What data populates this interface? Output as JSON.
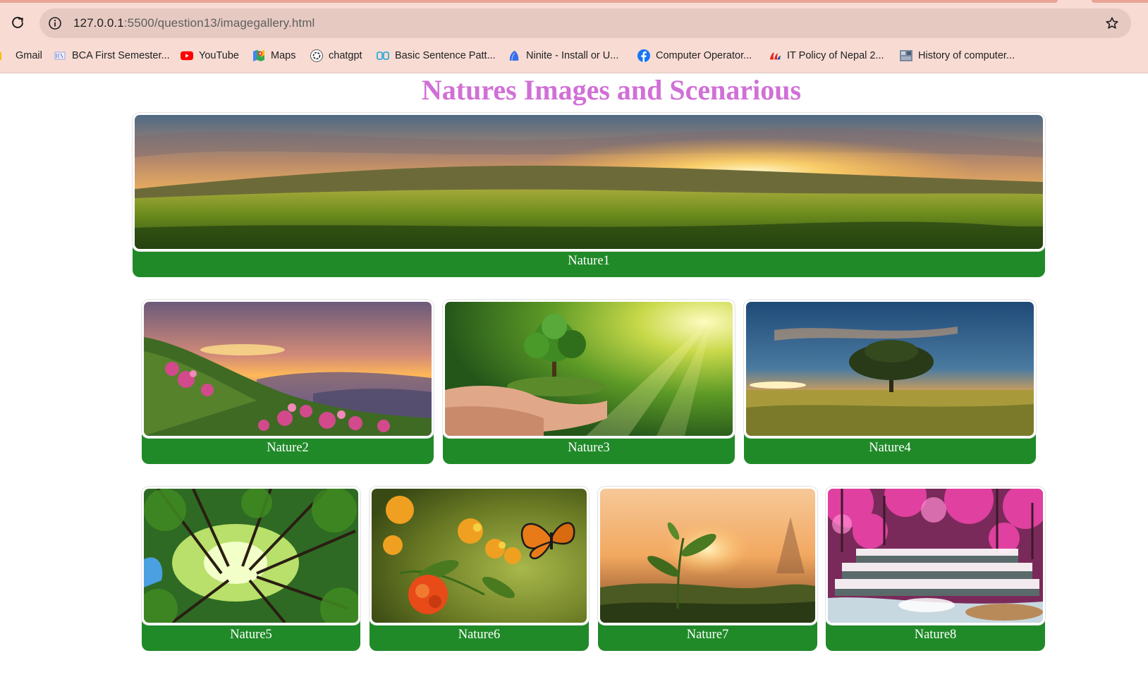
{
  "browser": {
    "url_host": "127.0.0.1",
    "url_path": ":5500/question13/imagegallery.html",
    "bookmarks": [
      {
        "label": "Gmail",
        "icon": "gmail-icon"
      },
      {
        "label": "BCA First Semester...",
        "icon": "bca-icon"
      },
      {
        "label": "YouTube",
        "icon": "youtube-icon"
      },
      {
        "label": "Maps",
        "icon": "maps-icon"
      },
      {
        "label": "chatgpt",
        "icon": "chatgpt-icon"
      },
      {
        "label": "Basic Sentence Patt...",
        "icon": "sentence-icon"
      },
      {
        "label": "Ninite - Install or U...",
        "icon": "ninite-icon"
      },
      {
        "label": "Computer Operator...",
        "icon": "facebook-icon"
      },
      {
        "label": "IT Policy of Nepal 2...",
        "icon": "it-policy-icon"
      },
      {
        "label": "History of computer...",
        "icon": "history-icon"
      }
    ]
  },
  "page": {
    "title": "Natures Images and Scenarious",
    "gallery": [
      {
        "caption": "Nature1",
        "scene": "sunset-meadow"
      },
      {
        "caption": "Nature2",
        "scene": "mountain-flowers-sunset"
      },
      {
        "caption": "Nature3",
        "scene": "tree-in-hands"
      },
      {
        "caption": "Nature4",
        "scene": "lone-tree-field"
      },
      {
        "caption": "Nature5",
        "scene": "forest-canopy"
      },
      {
        "caption": "Nature6",
        "scene": "butterfly-flowers"
      },
      {
        "caption": "Nature7",
        "scene": "tea-sprout-sunset"
      },
      {
        "caption": "Nature8",
        "scene": "pink-forest-waterfall"
      }
    ]
  },
  "colors": {
    "title": "#d070d6",
    "caption_bg": "#208a28",
    "caption_text": "#ffffff",
    "chrome_bg": "#f8dcd4"
  }
}
